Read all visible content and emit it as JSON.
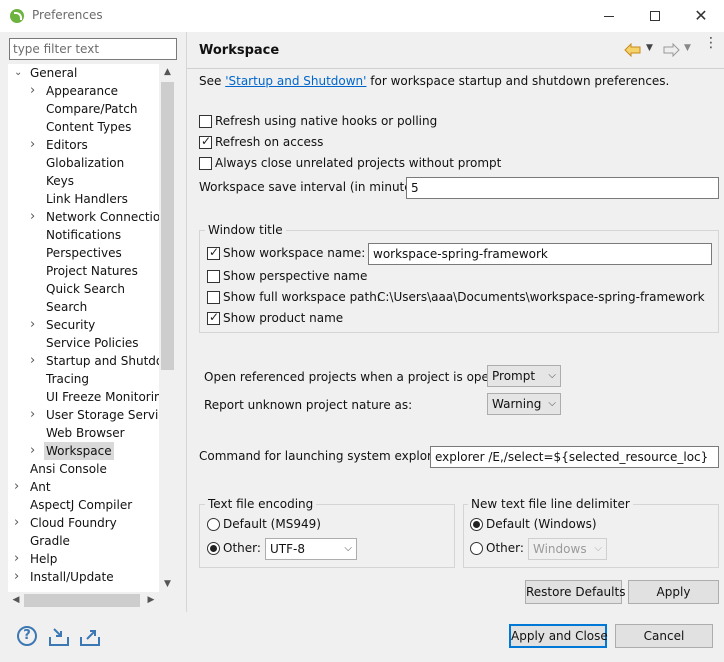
{
  "window": {
    "title": "Preferences",
    "close_glyph": "✕"
  },
  "filter": {
    "placeholder": "type filter text"
  },
  "tree": {
    "items": [
      {
        "label": "General",
        "level": 0,
        "twisty": "expanded"
      },
      {
        "label": "Appearance",
        "level": 1,
        "twisty": "collapsed"
      },
      {
        "label": "Compare/Patch",
        "level": 1,
        "twisty": "none"
      },
      {
        "label": "Content Types",
        "level": 1,
        "twisty": "none"
      },
      {
        "label": "Editors",
        "level": 1,
        "twisty": "collapsed"
      },
      {
        "label": "Globalization",
        "level": 1,
        "twisty": "none"
      },
      {
        "label": "Keys",
        "level": 1,
        "twisty": "none"
      },
      {
        "label": "Link Handlers",
        "level": 1,
        "twisty": "none"
      },
      {
        "label": "Network Connection",
        "level": 1,
        "twisty": "collapsed"
      },
      {
        "label": "Notifications",
        "level": 1,
        "twisty": "none"
      },
      {
        "label": "Perspectives",
        "level": 1,
        "twisty": "none"
      },
      {
        "label": "Project Natures",
        "level": 1,
        "twisty": "none"
      },
      {
        "label": "Quick Search",
        "level": 1,
        "twisty": "none"
      },
      {
        "label": "Search",
        "level": 1,
        "twisty": "none"
      },
      {
        "label": "Security",
        "level": 1,
        "twisty": "collapsed"
      },
      {
        "label": "Service Policies",
        "level": 1,
        "twisty": "none"
      },
      {
        "label": "Startup and Shutdow",
        "level": 1,
        "twisty": "collapsed"
      },
      {
        "label": "Tracing",
        "level": 1,
        "twisty": "none"
      },
      {
        "label": "UI Freeze Monitoring",
        "level": 1,
        "twisty": "none"
      },
      {
        "label": "User Storage Service",
        "level": 1,
        "twisty": "collapsed"
      },
      {
        "label": "Web Browser",
        "level": 1,
        "twisty": "none"
      },
      {
        "label": "Workspace",
        "level": 1,
        "twisty": "collapsed",
        "selected": true
      },
      {
        "label": "Ansi Console",
        "level": 0,
        "twisty": "none"
      },
      {
        "label": "Ant",
        "level": 0,
        "twisty": "collapsed"
      },
      {
        "label": "AspectJ Compiler",
        "level": 0,
        "twisty": "none"
      },
      {
        "label": "Cloud Foundry",
        "level": 0,
        "twisty": "collapsed"
      },
      {
        "label": "Gradle",
        "level": 0,
        "twisty": "none"
      },
      {
        "label": "Help",
        "level": 0,
        "twisty": "collapsed"
      },
      {
        "label": "Install/Update",
        "level": 0,
        "twisty": "collapsed"
      }
    ]
  },
  "page": {
    "title": "Workspace",
    "see_prefix": "See ",
    "see_link": "'Startup and Shutdown'",
    "see_suffix": " for workspace startup and shutdown preferences.",
    "refresh_native": {
      "label": "Refresh using native hooks or polling",
      "checked": false
    },
    "refresh_access": {
      "label": "Refresh on access",
      "checked": true
    },
    "always_close": {
      "label": "Always close unrelated projects without prompt",
      "checked": false
    },
    "save_interval": {
      "label": "Workspace save interval (in minutes):",
      "value": "5"
    },
    "window_title_group": {
      "title": "Window title",
      "show_ws_name": {
        "label": "Show workspace name:",
        "checked": true,
        "value": "workspace-spring-framework"
      },
      "show_perspective": {
        "label": "Show perspective name",
        "checked": false
      },
      "show_ws_path": {
        "label": "Show full workspace path:",
        "checked": false,
        "value": "C:\\Users\\aaa\\Documents\\workspace-spring-framework"
      },
      "show_product": {
        "label": "Show product name",
        "checked": true
      }
    },
    "open_referenced": {
      "label": "Open referenced projects when a project is opened:",
      "value": "Prompt"
    },
    "report_unknown": {
      "label": "Report unknown project nature as:",
      "value": "Warning"
    },
    "system_explorer": {
      "label": "Command for launching system explorer:",
      "value": "explorer /E,/select=${selected_resource_loc}"
    },
    "encoding_group": {
      "title": "Text file encoding",
      "default_label": "Default (MS949)",
      "other_label": "Other:",
      "other_value": "UTF-8",
      "selected": "other"
    },
    "delimiter_group": {
      "title": "New text file line delimiter",
      "default_label": "Default (Windows)",
      "other_label": "Other:",
      "other_value": "Windows",
      "selected": "default"
    },
    "restore_defaults": "Restore Defaults",
    "apply": "Apply"
  },
  "footer": {
    "apply_close": "Apply and Close",
    "cancel": "Cancel",
    "help_glyph": "?"
  },
  "icons": {
    "nav_back": "back-arrow-icon",
    "nav_forward": "forward-arrow-icon",
    "view_menu": "view-menu-icon",
    "help": "help-icon",
    "import": "import-icon",
    "export": "export-icon"
  },
  "colors": {
    "link": "#0066cc",
    "primary_border": "#0078d7",
    "back_arrow": "#e8a13a"
  }
}
